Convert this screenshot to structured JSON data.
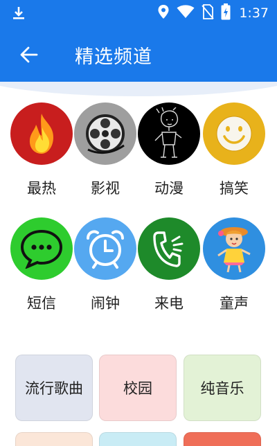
{
  "status_bar": {
    "time": "1:37",
    "icons": [
      "download-icon",
      "location-icon",
      "wifi-icon",
      "no-sim-icon",
      "battery-charging-icon"
    ]
  },
  "app_bar": {
    "title": "精选频道",
    "back_icon": "arrow-back-icon"
  },
  "channels": [
    {
      "label": "最热",
      "icon": "fire-icon",
      "color": "#c81e1e"
    },
    {
      "label": "影视",
      "icon": "film-reel-icon",
      "color": "#9e9e9e"
    },
    {
      "label": "动漫",
      "icon": "anime-character-icon",
      "color": "#000000"
    },
    {
      "label": "搞笑",
      "icon": "smiley-icon",
      "color": "#e8b21b"
    },
    {
      "label": "短信",
      "icon": "message-bubble-icon",
      "color": "#2ecc2e"
    },
    {
      "label": "闹钟",
      "icon": "alarm-clock-icon",
      "color": "#55a8f0"
    },
    {
      "label": "来电",
      "icon": "phone-ringing-icon",
      "color": "#1e8a2a"
    },
    {
      "label": "童声",
      "icon": "child-girl-icon",
      "color": "#2f8fe0"
    }
  ],
  "categories": [
    {
      "label": "流行歌曲",
      "color": "#e1e5f0"
    },
    {
      "label": "校园",
      "color": "#fcdcdc"
    },
    {
      "label": "纯音乐",
      "color": "#e3f2d6"
    },
    {
      "label": "",
      "color": "#fbe6d8"
    },
    {
      "label": "",
      "color": "#c9ecf5"
    },
    {
      "label": "",
      "color": "#ef6e58"
    }
  ]
}
